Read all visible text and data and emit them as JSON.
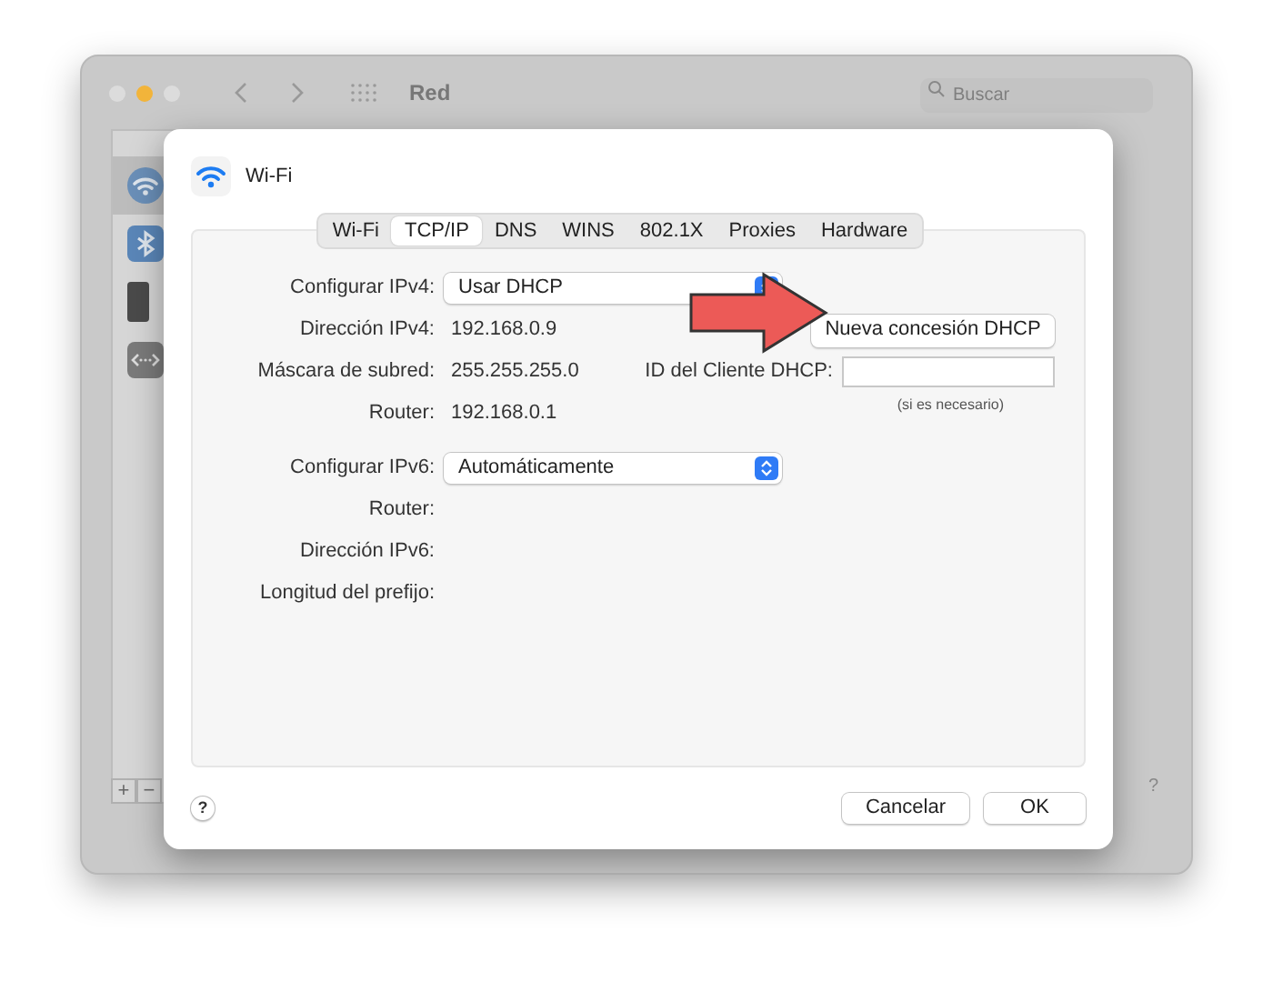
{
  "window": {
    "title": "Red",
    "search": {
      "placeholder": "Buscar"
    },
    "help": "?",
    "list_buttons": [
      "+",
      "−"
    ]
  },
  "sidebar": {
    "items": [
      {
        "kind": "wifi",
        "selected": true
      },
      {
        "kind": "bluetooth",
        "selected": false
      },
      {
        "kind": "phone",
        "selected": false
      },
      {
        "kind": "ethernet",
        "selected": false
      }
    ]
  },
  "sheet": {
    "title": "Wi-Fi",
    "tabs": [
      {
        "label": "Wi-Fi",
        "selected": false
      },
      {
        "label": "TCP/IP",
        "selected": true
      },
      {
        "label": "DNS",
        "selected": false
      },
      {
        "label": "WINS",
        "selected": false
      },
      {
        "label": "802.1X",
        "selected": false
      },
      {
        "label": "Proxies",
        "selected": false
      },
      {
        "label": "Hardware",
        "selected": false
      }
    ],
    "ipv4_rows": [
      {
        "kind": "popup",
        "label": "Configurar IPv4:",
        "value": "Usar DHCP"
      },
      {
        "kind": "value",
        "label": "Dirección IPv4:",
        "value": "192.168.0.9",
        "button": "Nueva concesión DHCP"
      },
      {
        "kind": "value",
        "label": "Máscara de subred:",
        "value": "255.255.255.0",
        "field_label": "ID del Cliente DHCP:",
        "field_hint": "(si es necesario)"
      },
      {
        "kind": "value",
        "label": "Router:",
        "value": "192.168.0.1"
      }
    ],
    "ipv6_rows": [
      {
        "kind": "popup",
        "label": "Configurar IPv6:",
        "value": "Automáticamente"
      },
      {
        "kind": "value",
        "label": "Router:"
      },
      {
        "kind": "value",
        "label": "Dirección IPv6:"
      },
      {
        "kind": "value",
        "label": "Longitud del prefijo:"
      }
    ],
    "help": "?",
    "buttons": [
      "Cancelar",
      "OK"
    ]
  }
}
